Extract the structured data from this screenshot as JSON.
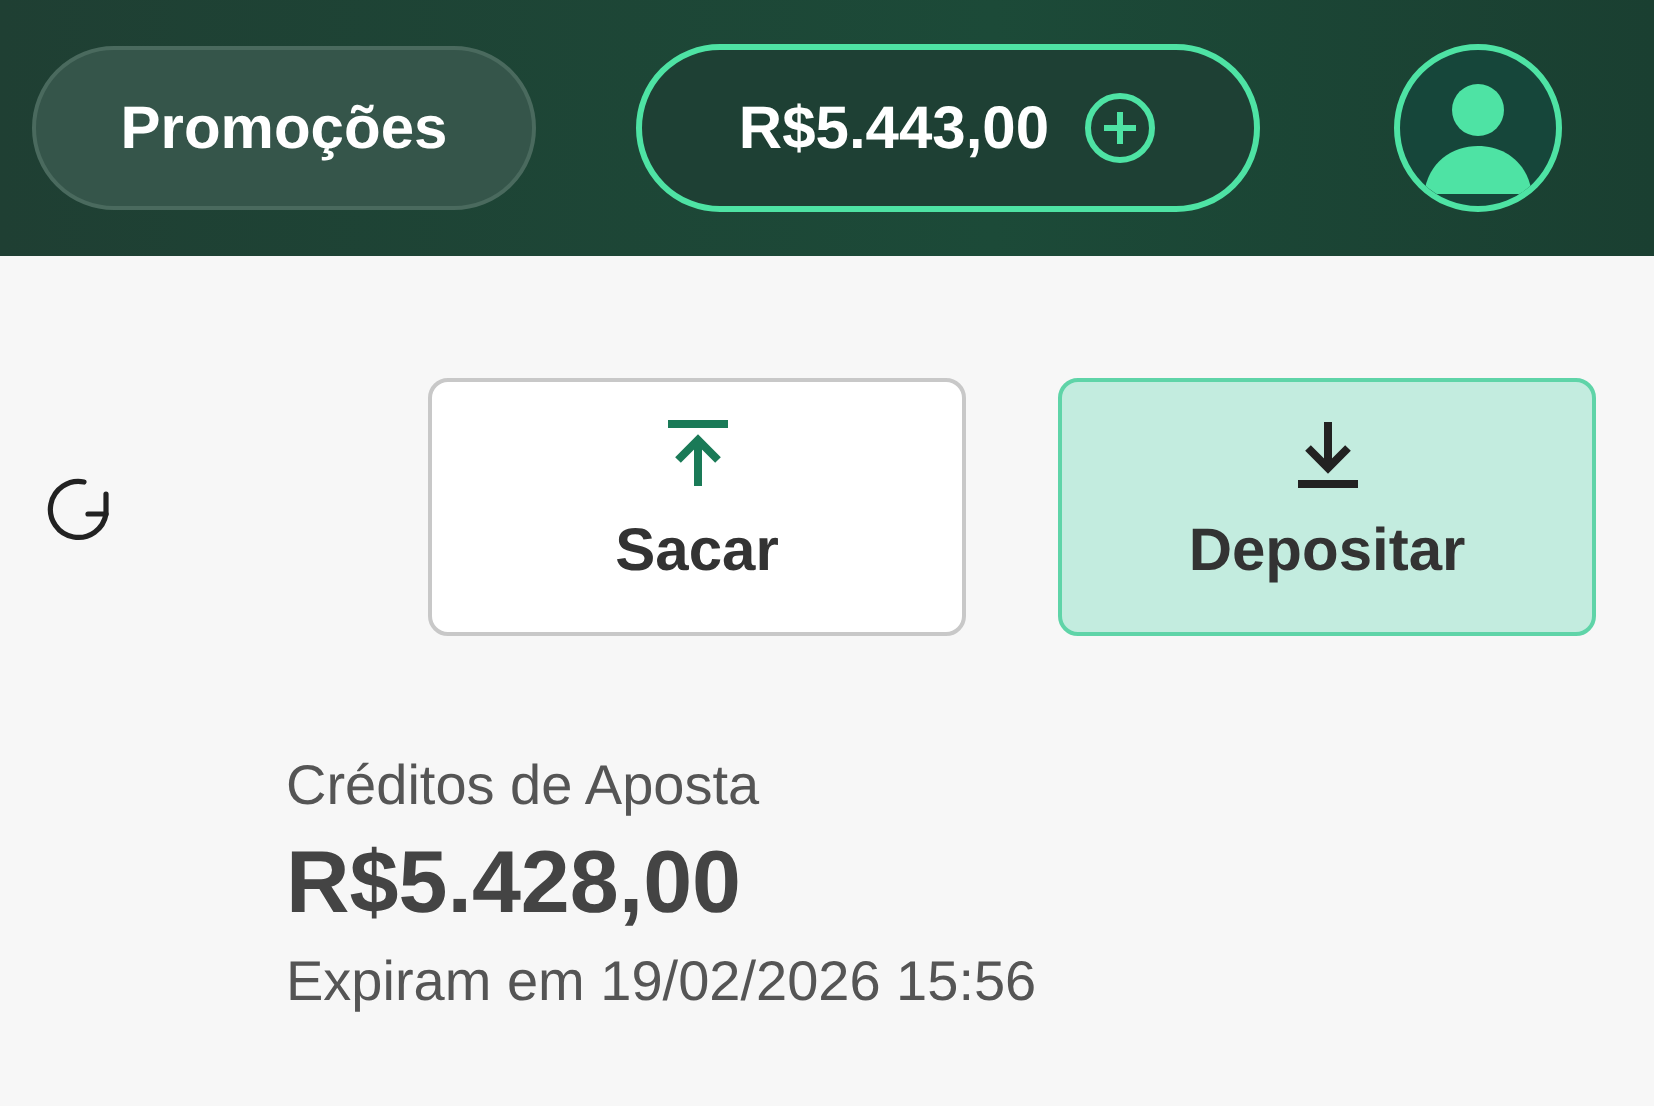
{
  "header": {
    "promo_button": "Promoções",
    "balance": "R$5.443,00"
  },
  "actions": [
    {
      "label": "Sacar",
      "kind": "withdraw"
    },
    {
      "label": "Depositar",
      "kind": "deposit"
    }
  ],
  "credits": {
    "title": "Créditos de Aposta",
    "amount": "R$5.428,00",
    "expiry": "Expiram em 19/02/2026 15:56"
  }
}
